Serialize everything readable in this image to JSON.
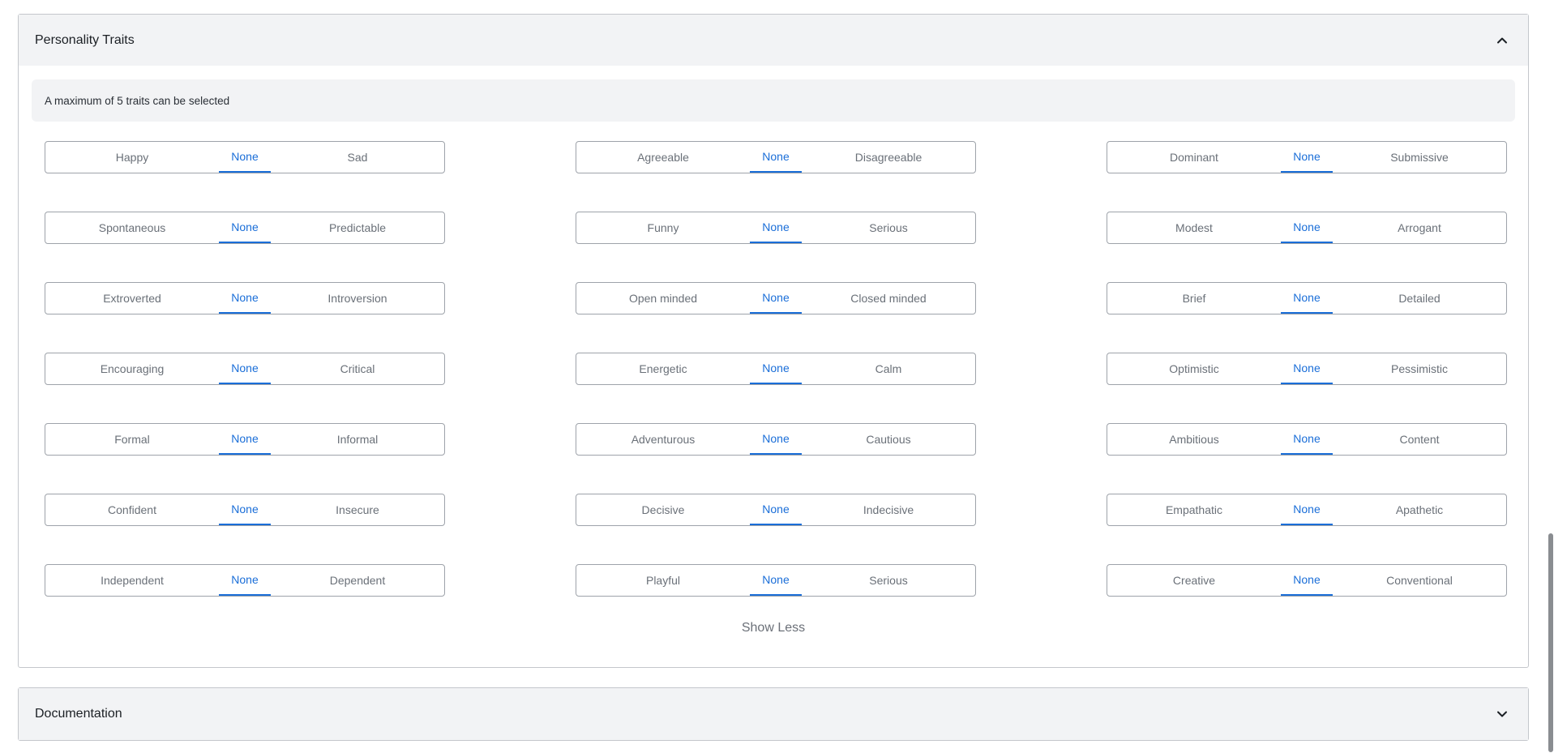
{
  "personality": {
    "title": "Personality Traits",
    "note": "A maximum of 5 traits can be selected",
    "show_less_label": "Show Less",
    "none_label": "None",
    "rows": [
      [
        {
          "left": "Happy",
          "right": "Sad"
        },
        {
          "left": "Agreeable",
          "right": "Disagreeable"
        },
        {
          "left": "Dominant",
          "right": "Submissive"
        }
      ],
      [
        {
          "left": "Spontaneous",
          "right": "Predictable"
        },
        {
          "left": "Funny",
          "right": "Serious"
        },
        {
          "left": "Modest",
          "right": "Arrogant"
        }
      ],
      [
        {
          "left": "Extroverted",
          "right": "Introversion"
        },
        {
          "left": "Open minded",
          "right": "Closed minded"
        },
        {
          "left": "Brief",
          "right": "Detailed"
        }
      ],
      [
        {
          "left": "Encouraging",
          "right": "Critical"
        },
        {
          "left": "Energetic",
          "right": "Calm"
        },
        {
          "left": "Optimistic",
          "right": "Pessimistic"
        }
      ],
      [
        {
          "left": "Formal",
          "right": "Informal"
        },
        {
          "left": "Adventurous",
          "right": "Cautious"
        },
        {
          "left": "Ambitious",
          "right": "Content"
        }
      ],
      [
        {
          "left": "Confident",
          "right": "Insecure"
        },
        {
          "left": "Decisive",
          "right": "Indecisive"
        },
        {
          "left": "Empathatic",
          "right": "Apathetic"
        }
      ],
      [
        {
          "left": "Independent",
          "right": "Dependent"
        },
        {
          "left": "Playful",
          "right": "Serious"
        },
        {
          "left": "Creative",
          "right": "Conventional"
        }
      ]
    ],
    "selected_value": "None",
    "accent_color": "#1a6ed8",
    "collapse_icon": "chevron-up-icon"
  },
  "documentation": {
    "title": "Documentation",
    "expand_icon": "chevron-down-icon"
  }
}
